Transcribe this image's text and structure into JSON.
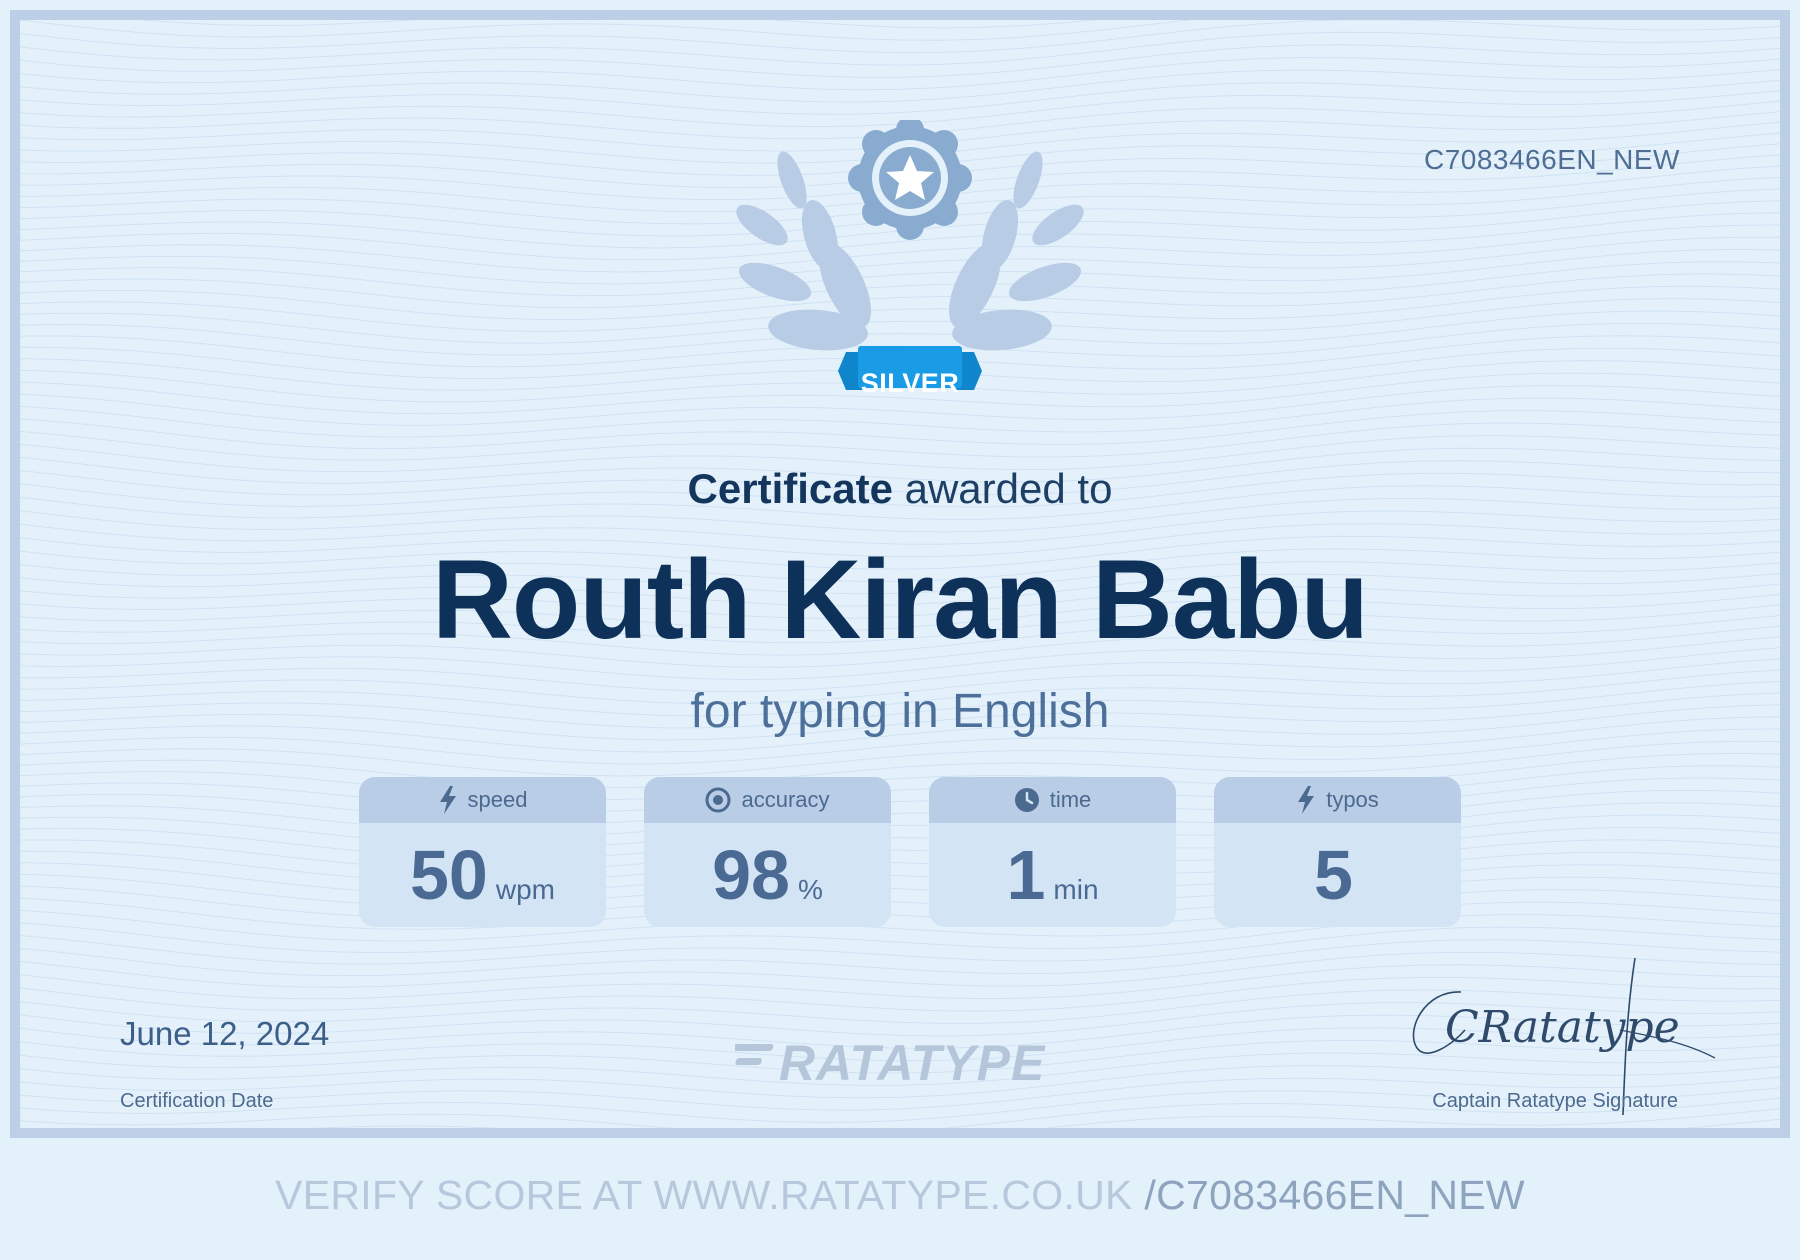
{
  "certificate": {
    "id": "C7083466EN_NEW",
    "level": "SILVER",
    "heading_bold": "Certificate",
    "heading_rest": " awarded to",
    "recipient": "Routh Kiran Babu",
    "subject": "for typing in English",
    "date": "June 12, 2024",
    "date_label": "Certification Date",
    "signature_label": "Captain Ratatype Signature",
    "signature_text": "CRatatype"
  },
  "stats": [
    {
      "label": "speed",
      "value": "50",
      "unit": "wpm",
      "icon": "lightning-icon"
    },
    {
      "label": "accuracy",
      "value": "98",
      "unit": "%",
      "icon": "target-icon"
    },
    {
      "label": "time",
      "value": "1",
      "unit": "min",
      "icon": "clock-icon"
    },
    {
      "label": "typos",
      "value": "5",
      "unit": "",
      "icon": "lightning-icon"
    }
  ],
  "logo": {
    "text": "RATATYPE"
  },
  "footer": {
    "verify_prefix": "VERIFY SCORE AT WWW.RATATYPE.CO.UK ",
    "verify_code": "/C7083466EN_NEW"
  },
  "colors": {
    "background": "#e4f1fb",
    "border": "#bccfe7",
    "ribbon": "#1a9be6",
    "name": "#0d3158",
    "emblem": "#8aabd0"
  }
}
